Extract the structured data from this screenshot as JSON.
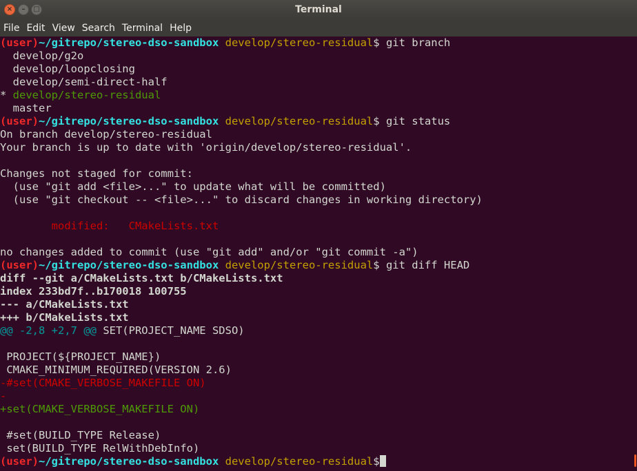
{
  "window": {
    "title": "Terminal"
  },
  "menubar": {
    "items": [
      "File",
      "Edit",
      "View",
      "Search",
      "Terminal",
      "Help"
    ]
  },
  "prompt": {
    "user": "(user)",
    "path": "~/gitrepo/stereo-dso-sandbox",
    "branch": "develop/stereo-residual",
    "symbol": "$"
  },
  "lines": [
    {
      "type": "prompt",
      "cmd": " git branch"
    },
    {
      "type": "text",
      "text": "  develop/g2o"
    },
    {
      "type": "text",
      "text": "  develop/loopclosing"
    },
    {
      "type": "text",
      "text": "  develop/semi-direct-half"
    },
    {
      "type": "current-branch",
      "star": "* ",
      "text": "develop/stereo-residual"
    },
    {
      "type": "text",
      "text": "  master"
    },
    {
      "type": "prompt",
      "cmd": " git status"
    },
    {
      "type": "text",
      "text": "On branch develop/stereo-residual"
    },
    {
      "type": "text",
      "text": "Your branch is up to date with 'origin/develop/stereo-residual'."
    },
    {
      "type": "text",
      "text": ""
    },
    {
      "type": "text",
      "text": "Changes not staged for commit:"
    },
    {
      "type": "text",
      "text": "  (use \"git add <file>...\" to update what will be committed)"
    },
    {
      "type": "text",
      "text": "  (use \"git checkout -- <file>...\" to discard changes in working directory)"
    },
    {
      "type": "text",
      "text": ""
    },
    {
      "type": "red",
      "text": "        modified:   CMakeLists.txt"
    },
    {
      "type": "text",
      "text": ""
    },
    {
      "type": "text",
      "text": "no changes added to commit (use \"git add\" and/or \"git commit -a\")"
    },
    {
      "type": "prompt",
      "cmd": " git diff HEAD"
    },
    {
      "type": "bold",
      "text": "diff --git a/CMakeLists.txt b/CMakeLists.txt"
    },
    {
      "type": "bold",
      "text": "index 233bd7f..b170018 100755"
    },
    {
      "type": "bold",
      "text": "--- a/CMakeLists.txt"
    },
    {
      "type": "bold",
      "text": "+++ b/CMakeLists.txt"
    },
    {
      "type": "hunk",
      "hunk": "@@ -2,8 +2,7 @@",
      "context": " SET(PROJECT_NAME SDSO)"
    },
    {
      "type": "text",
      "text": ""
    },
    {
      "type": "text",
      "text": " PROJECT(${PROJECT_NAME})"
    },
    {
      "type": "text",
      "text": " CMAKE_MINIMUM_REQUIRED(VERSION 2.6)"
    },
    {
      "type": "red",
      "text": "-#set(CMAKE_VERBOSE_MAKEFILE ON)"
    },
    {
      "type": "red",
      "text": "-"
    },
    {
      "type": "green",
      "text": "+set(CMAKE_VERBOSE_MAKEFILE ON)"
    },
    {
      "type": "text",
      "text": ""
    },
    {
      "type": "text",
      "text": " #set(BUILD_TYPE Release)"
    },
    {
      "type": "text",
      "text": " set(BUILD_TYPE RelWithDebInfo)"
    },
    {
      "type": "prompt-cursor",
      "cmd": ""
    }
  ],
  "colors": {
    "background": "#300a24",
    "titlebar": "#3c3b37",
    "user": "#ef2929",
    "path": "#34e2e2",
    "branch": "#c4a000",
    "added": "#4e9a06",
    "removed": "#cc0000",
    "hunk": "#06989a",
    "scroll_accent": "#e95420"
  }
}
